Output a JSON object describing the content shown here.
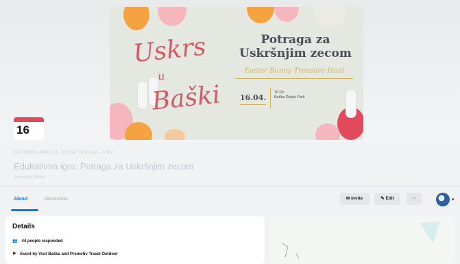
{
  "cover": {
    "poster": {
      "script_title_line1": "Uskrs",
      "script_title_line2": "u",
      "script_title_line3": "Baški",
      "title_line1": "Potraga za",
      "title_line2": "Uskršnjim zecom",
      "subtitle": "Easter Bunny Treasure Hunt",
      "date": "16.04.",
      "time_line1": "10:00",
      "time_line2": "Baška Rajski Park",
      "accent_colors": [
        "#e3495c",
        "#f4a340",
        "#f5b7bd",
        "#d4b44f"
      ]
    }
  },
  "event": {
    "month_badge_color": "#e3495c",
    "day": "16",
    "datetime": "SATURDAY, APRIL 16, 2022 AT 10:00 AM – 1 PM",
    "title": "Edukativna igra: Potraga za Uskršnjim zecom",
    "location": "Jurandvor, Baška"
  },
  "tabs": [
    {
      "label": "About",
      "active": true
    },
    {
      "label": "Discussion",
      "active": false
    }
  ],
  "actions": {
    "invite": "Invite",
    "edit": "Edit",
    "more": "···"
  },
  "details": {
    "heading": "Details",
    "responded": "44 people responded",
    "organizer": "Event by Visit Baška and Premotiv Travel Outdoor"
  },
  "icons": [
    "calendar-icon",
    "invite-icon",
    "edit-icon",
    "more-icon",
    "avatar-icon",
    "chevron-down-icon",
    "people-icon",
    "flag-icon",
    "map-icon"
  ]
}
